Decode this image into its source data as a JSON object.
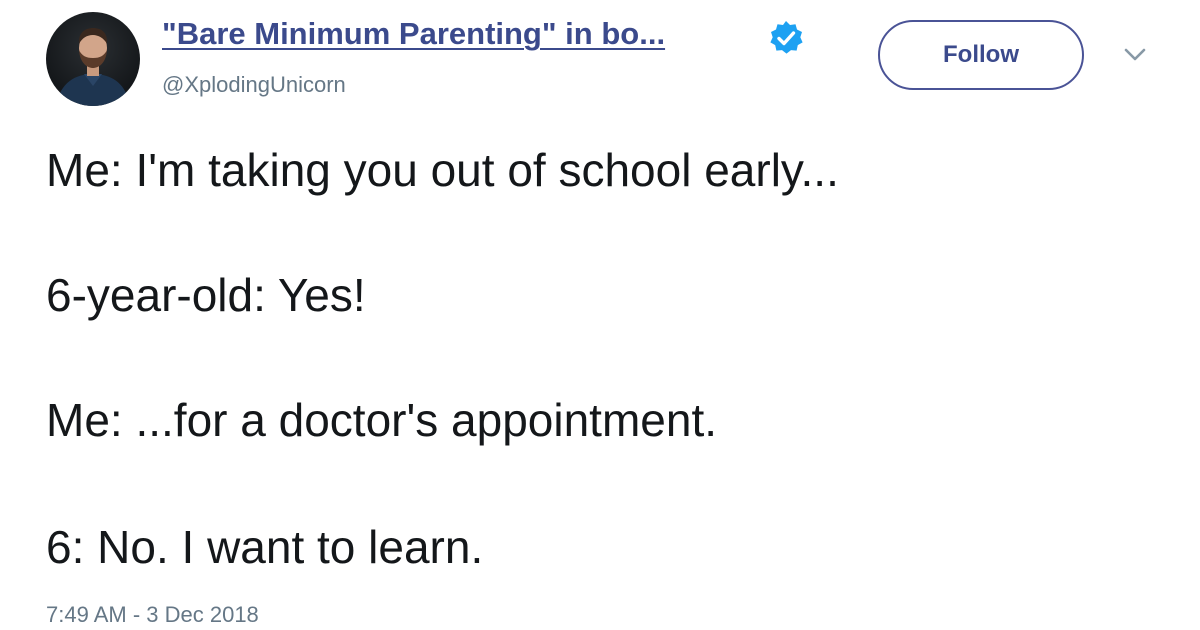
{
  "author": {
    "display_name": "\"Bare Minimum Parenting\" in bo...",
    "handle": "@XplodingUnicorn",
    "verified": true,
    "avatar_icon": "user-avatar"
  },
  "follow_button": {
    "label": "Follow"
  },
  "menu_icon": "chevron-down-icon",
  "tweet": {
    "lines": [
      "Me: I'm taking you out of school early...",
      "6-year-old: Yes!",
      "Me: ...for a doctor's appointment.",
      "6: No. I want to learn."
    ],
    "timestamp": "7:49 AM - 3 Dec 2018"
  },
  "colors": {
    "link": "#3b4a8c",
    "verified_badge": "#1da1f2",
    "secondary_text": "#657786",
    "body_text": "#14171a"
  }
}
